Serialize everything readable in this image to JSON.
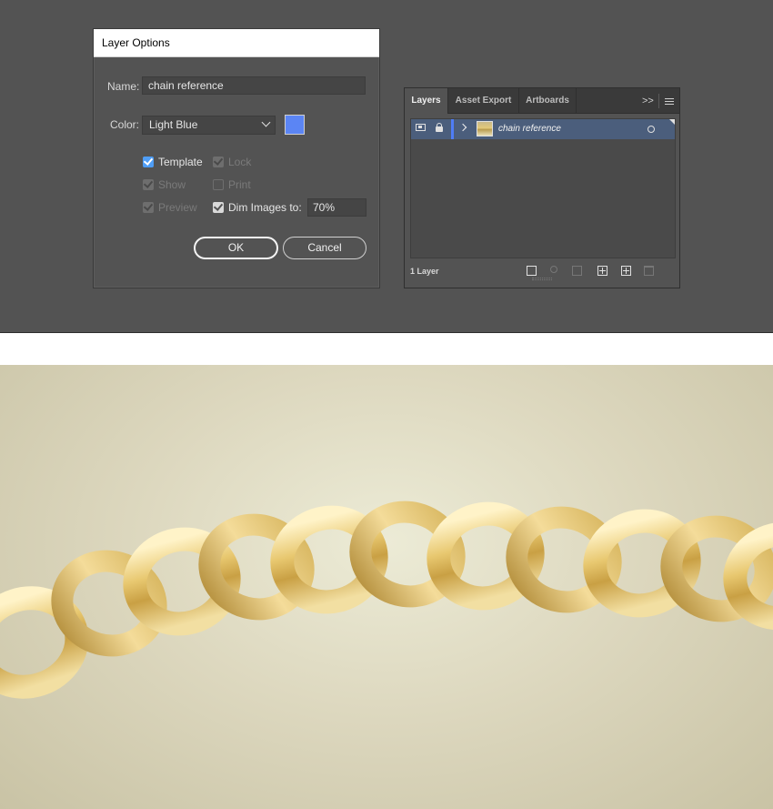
{
  "dialog": {
    "title": "Layer Options",
    "name_label": "Name:",
    "name_value": "chain reference",
    "color_label": "Color:",
    "color_value": "Light Blue",
    "swatch_color": "#5b85f4",
    "options": {
      "template": "Template",
      "lock": "Lock",
      "show": "Show",
      "print": "Print",
      "preview": "Preview",
      "dim_images": "Dim Images to:"
    },
    "dim_value": "70%",
    "ok_label": "OK",
    "cancel_label": "Cancel"
  },
  "layers_panel": {
    "tabs": [
      "Layers",
      "Asset Export",
      "Artboards"
    ],
    "collapse_label": ">>",
    "layer": {
      "name": "chain reference",
      "color": "#4f7df7"
    },
    "footer_label": "1 Layer"
  },
  "colors": {
    "workspace": "#535353",
    "selected_row": "#4b5e7c",
    "checkbox_accent": "#4f9ef7"
  }
}
